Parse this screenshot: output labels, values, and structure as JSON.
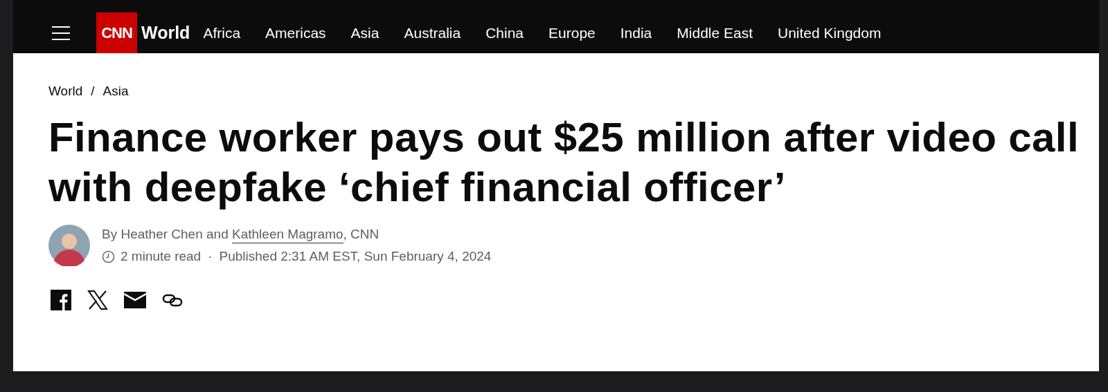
{
  "nav": {
    "logo_text": "CNN",
    "section": "World",
    "links": [
      "Africa",
      "Americas",
      "Asia",
      "Australia",
      "China",
      "Europe",
      "India",
      "Middle East",
      "United Kingdom"
    ]
  },
  "breadcrumb": [
    "World",
    "Asia"
  ],
  "breadcrumb_separator": "/",
  "headline": "Finance worker pays out $25 million after video call with deepfake ‘chief financial officer’",
  "byline": {
    "prefix": "By Heather Chen and ",
    "author_link": "Kathleen Magramo",
    "suffix": ", CNN"
  },
  "meta": {
    "read_time": "2 minute read",
    "separator": "·",
    "published": "Published 2:31 AM EST, Sun February 4, 2024"
  }
}
